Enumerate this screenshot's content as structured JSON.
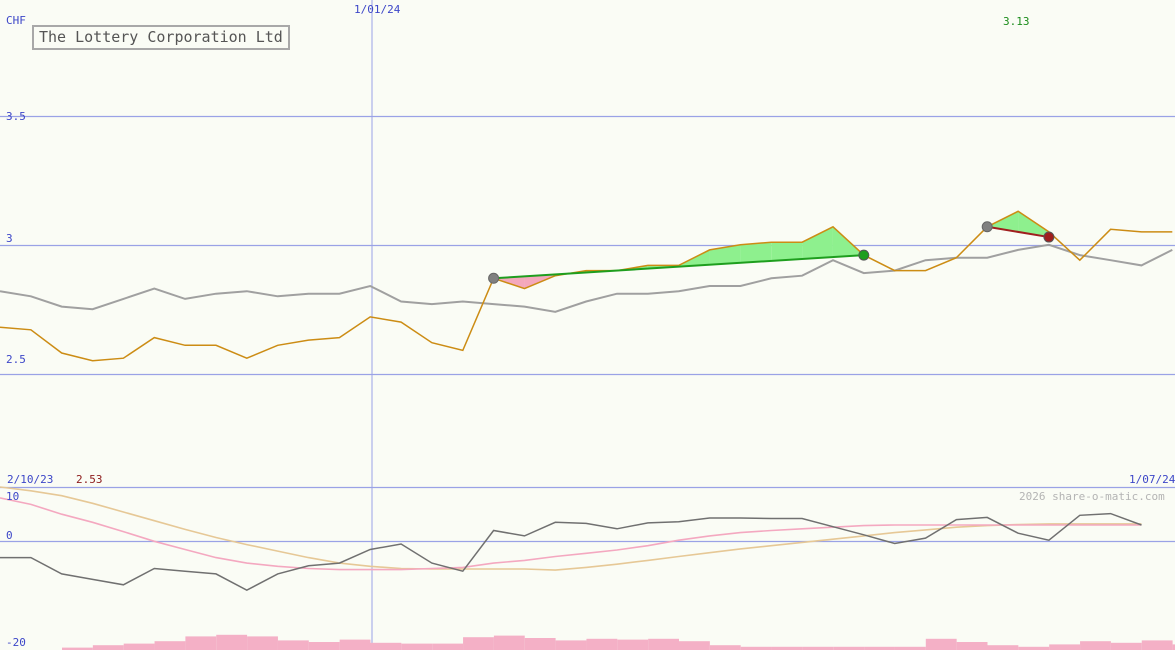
{
  "chart_data": {
    "type": "line",
    "title": "The Lottery Corporation Ltd",
    "currency": "CHF",
    "watermark": "2026 share-o-matic.com",
    "x_labels": {
      "start": "2/10/23",
      "mid": "1/01/24",
      "end": "1/07/24"
    },
    "high_label": "3.13",
    "low_label": "2.53",
    "price_axis": {
      "ticks": [
        "3.5",
        "3",
        "2.5"
      ],
      "ylim": [
        2.06,
        3.95
      ],
      "grid": true
    },
    "indicator_axis": {
      "ticks": [
        "10",
        "0",
        "-20"
      ],
      "ylim": [
        -20,
        10
      ]
    },
    "colors": {
      "background": "#fafcf5",
      "grid": "#9aa2e6",
      "price": "#cc8c14",
      "comparison": "#a0a0a0",
      "gain_fill": "#8ef08e",
      "loss_fill": "#f4a8bc",
      "trade_win": "#1e9e1e",
      "trade_loss": "#a01e1e",
      "osc": "#707070",
      "osc_slow": "#f4a8c0",
      "osc_signal": "#e6c896",
      "volume": "#f4b0c6",
      "high_label": "#1a8c1a",
      "low_label": "#8c1a1a"
    },
    "series": [
      {
        "name": "price",
        "values": [
          2.68,
          2.67,
          2.58,
          2.55,
          2.56,
          2.64,
          2.61,
          2.61,
          2.56,
          2.61,
          2.63,
          2.64,
          2.72,
          2.7,
          2.62,
          2.59,
          2.87,
          2.83,
          2.88,
          2.9,
          2.9,
          2.92,
          2.92,
          2.98,
          3.0,
          3.01,
          3.01,
          3.07,
          2.96,
          2.9,
          2.9,
          2.95,
          3.07,
          3.13,
          3.05,
          2.94,
          3.06,
          3.05,
          3.05
        ]
      },
      {
        "name": "comparison",
        "values": [
          2.82,
          2.8,
          2.76,
          2.75,
          2.79,
          2.83,
          2.79,
          2.81,
          2.82,
          2.8,
          2.81,
          2.81,
          2.84,
          2.78,
          2.77,
          2.78,
          2.77,
          2.76,
          2.74,
          2.78,
          2.81,
          2.81,
          2.82,
          2.84,
          2.84,
          2.87,
          2.88,
          2.94,
          2.89,
          2.9,
          2.94,
          2.95,
          2.95,
          2.98,
          3.0,
          2.96,
          2.94,
          2.92,
          2.98
        ]
      }
    ],
    "trades": [
      {
        "from_index": 16,
        "to_index": 28,
        "from_value": 2.87,
        "to_value": 2.96,
        "result": "win"
      },
      {
        "from_index": 32,
        "to_index": 34,
        "from_value": 3.07,
        "to_value": 3.03,
        "result": "loss"
      }
    ],
    "indicators": [
      {
        "name": "osc",
        "values": [
          -3,
          -3,
          -6,
          -7,
          -8,
          -5,
          -5.5,
          -6,
          -9,
          -6,
          -4.5,
          -4,
          -1.5,
          -0.5,
          -4,
          -5.5,
          2,
          1,
          3.5,
          3.3,
          2.3,
          3.4,
          3.6,
          4.3,
          4.3,
          4.2,
          4.2,
          2.7,
          1.2,
          -0.4,
          0.6,
          4.0,
          4.4,
          1.5,
          0.2,
          4.8,
          5.1,
          3.0
        ]
      },
      {
        "name": "osc_slow",
        "values": [
          8,
          6.8,
          5,
          3.5,
          1.8,
          0,
          -1.5,
          -3,
          -4,
          -4.6,
          -5,
          -5.2,
          -5.2,
          -5.2,
          -5.0,
          -4.8,
          -4.0,
          -3.5,
          -2.8,
          -2.2,
          -1.6,
          -0.8,
          0.2,
          1.0,
          1.6,
          2.0,
          2.3,
          2.6,
          2.9,
          3.0,
          3.0,
          3.0,
          3.0,
          3.0,
          3.0,
          3.0,
          3.0,
          3.0
        ]
      },
      {
        "name": "osc_signal",
        "values": [
          10.0,
          9.3,
          8.4,
          7.0,
          5.4,
          3.8,
          2.2,
          0.7,
          -0.6,
          -1.8,
          -3.0,
          -4.0,
          -4.6,
          -5.0,
          -5.1,
          -5.1,
          -5.1,
          -5.1,
          -5.3,
          -4.8,
          -4.2,
          -3.5,
          -2.8,
          -2.1,
          -1.4,
          -0.8,
          -0.2,
          0.4,
          1.0,
          1.6,
          2.1,
          2.6,
          2.9,
          3.1,
          3.2,
          3.2,
          3.2,
          3.2
        ]
      }
    ],
    "volume": [
      0.15,
      0.3,
      0.4,
      0.55,
      0.85,
      0.95,
      0.85,
      0.6,
      0.5,
      0.65,
      0.45,
      0.4,
      0.4,
      0.8,
      0.9,
      0.75,
      0.6,
      0.7,
      0.65,
      0.7,
      0.55,
      0.3,
      0.2,
      0.2,
      0.2,
      0.2,
      0.2,
      0.2,
      0.7,
      0.5,
      0.3,
      0.2,
      0.35,
      0.55,
      0.45,
      0.6,
      0.35,
      0.35
    ]
  }
}
